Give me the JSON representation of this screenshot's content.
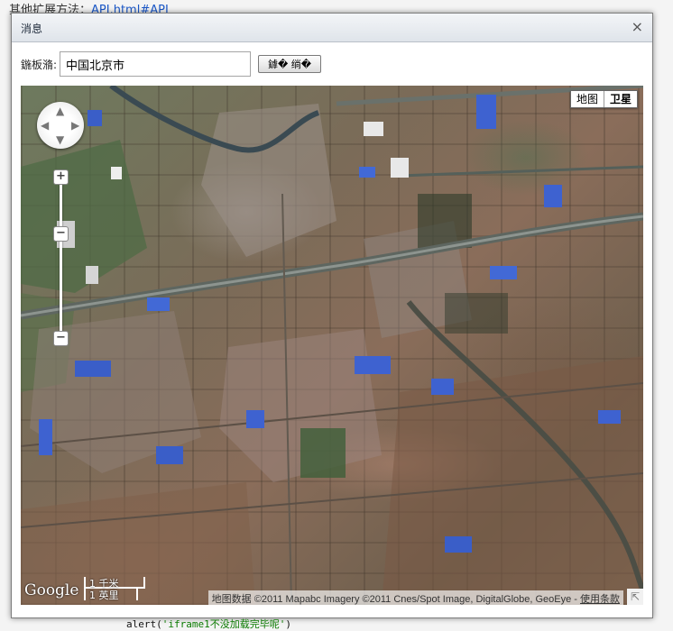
{
  "background_page": {
    "top_text": "其他扩展方法：",
    "top_link": "API.html#API",
    "bottom_code_prefix": "alert(",
    "bottom_code_string": "'iframe1不没加载完毕呢'",
    "bottom_code_suffix": ")"
  },
  "dialog": {
    "title": "消息",
    "close_glyph": "×"
  },
  "toolbar": {
    "address_label": "鍦板潃:",
    "address_value": "中国北京市",
    "search_button": "鎼� 绱�"
  },
  "map": {
    "type_buttons": [
      {
        "label": "地图",
        "active": false
      },
      {
        "label": "卫星",
        "active": true
      }
    ],
    "zoom_in": "+",
    "zoom_out": "−",
    "zoom_handle": "−",
    "logo": "Google",
    "scale_km": "1 千米",
    "scale_mi": "1 英里",
    "copyright": "地图数据 ©2011 Mapabc Imagery ©2011 Cnes/Spot Image, DigitalGlobe, GeoEye - ",
    "terms_link": "使用条款",
    "resize_glyph": "⇱"
  }
}
